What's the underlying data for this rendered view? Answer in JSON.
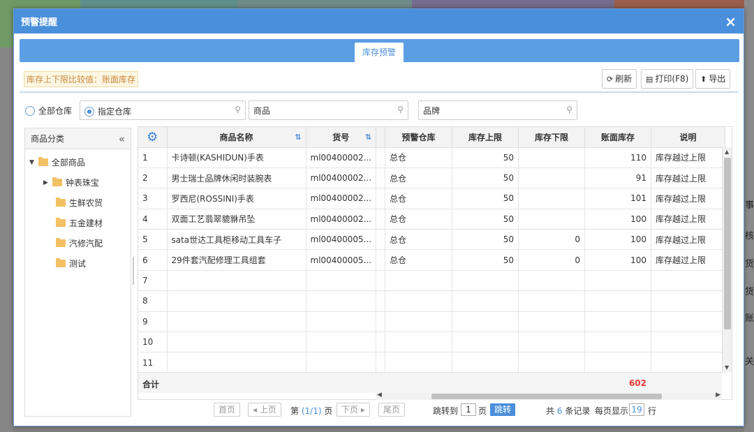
{
  "dialog": {
    "title": "预警提醒",
    "close_icon": "×"
  },
  "tabs": [
    {
      "label": "库存预警",
      "active": true
    }
  ],
  "toolbar": {
    "notice": "库存上下限比较值：账面库存",
    "refresh_label": "刷新",
    "print_label": "打印(F8)",
    "export_label": "导出"
  },
  "filters": {
    "radio_all": "全部仓库",
    "radio_specified": "指定仓库",
    "product_placeholder": "商品",
    "brand_placeholder": "品牌"
  },
  "tree": {
    "header": "商品分类",
    "collapse_icon": "«",
    "root": "全部商品",
    "items": [
      "钟表珠宝",
      "生鲜农贸",
      "五金建材",
      "汽修汽配",
      "测试"
    ]
  },
  "grid": {
    "columns": [
      "商品名称",
      "货号",
      "预警仓库",
      "库存上限",
      "库存下限",
      "账面库存",
      "说明"
    ],
    "rows": [
      {
        "idx": "1",
        "name": "卡诗顿(KASHIDUN)手表",
        "code": "ml00400002...",
        "warehouse": "总仓",
        "upper": "50",
        "lower": "",
        "stock": "110",
        "note": "库存越过上限"
      },
      {
        "idx": "2",
        "name": "男士瑞士品牌休闲时装腕表",
        "code": "ml00400002...",
        "warehouse": "总仓",
        "upper": "50",
        "lower": "",
        "stock": "91",
        "note": "库存越过上限"
      },
      {
        "idx": "3",
        "name": "罗西尼(ROSSINI)手表",
        "code": "ml00400002...",
        "warehouse": "总仓",
        "upper": "50",
        "lower": "",
        "stock": "101",
        "note": "库存越过上限"
      },
      {
        "idx": "4",
        "name": "双面工艺翡翠貔貅吊坠",
        "code": "ml00400002...",
        "warehouse": "总仓",
        "upper": "50",
        "lower": "",
        "stock": "100",
        "note": "库存越过上限"
      },
      {
        "idx": "5",
        "name": "sata世达工具柜移动工具车子",
        "code": "ml00400005...",
        "warehouse": "总仓",
        "upper": "50",
        "lower": "0",
        "stock": "100",
        "note": "库存越过上限"
      },
      {
        "idx": "6",
        "name": "29件套汽配修理工具组套",
        "code": "ml00400005...",
        "warehouse": "总仓",
        "upper": "50",
        "lower": "0",
        "stock": "100",
        "note": "库存越过上限"
      },
      {
        "idx": "7",
        "name": "",
        "code": "",
        "warehouse": "",
        "upper": "",
        "lower": "",
        "stock": "",
        "note": ""
      },
      {
        "idx": "8",
        "name": "",
        "code": "",
        "warehouse": "",
        "upper": "",
        "lower": "",
        "stock": "",
        "note": ""
      },
      {
        "idx": "9",
        "name": "",
        "code": "",
        "warehouse": "",
        "upper": "",
        "lower": "",
        "stock": "",
        "note": ""
      },
      {
        "idx": "10",
        "name": "",
        "code": "",
        "warehouse": "",
        "upper": "",
        "lower": "",
        "stock": "",
        "note": ""
      },
      {
        "idx": "11",
        "name": "",
        "code": "",
        "warehouse": "",
        "upper": "",
        "lower": "",
        "stock": "",
        "note": ""
      }
    ],
    "total_label": "合计",
    "total_stock": "602"
  },
  "pager": {
    "first": "首页",
    "prev": "上页",
    "page_prefix": "第",
    "page_info": "(1/1)",
    "page_suffix": "页",
    "next": "下页",
    "last": "尾页",
    "jump_prefix": "跳转到",
    "jump_value": "1",
    "jump_suffix": "页",
    "jump_button": "跳转",
    "records_prefix": "共",
    "records_count": "6",
    "records_suffix": "条记录",
    "per_page_prefix": "每页显示",
    "per_page_value": "19",
    "per_page_suffix": "行"
  },
  "background": {
    "right_glyphs": [
      "事",
      "核",
      "货",
      "货",
      "账",
      "关"
    ]
  },
  "colors": {
    "primary": "#4a8fdb",
    "tab_bar": "#5b9ee4",
    "total": "#e53935",
    "notice": "#c9883b"
  }
}
